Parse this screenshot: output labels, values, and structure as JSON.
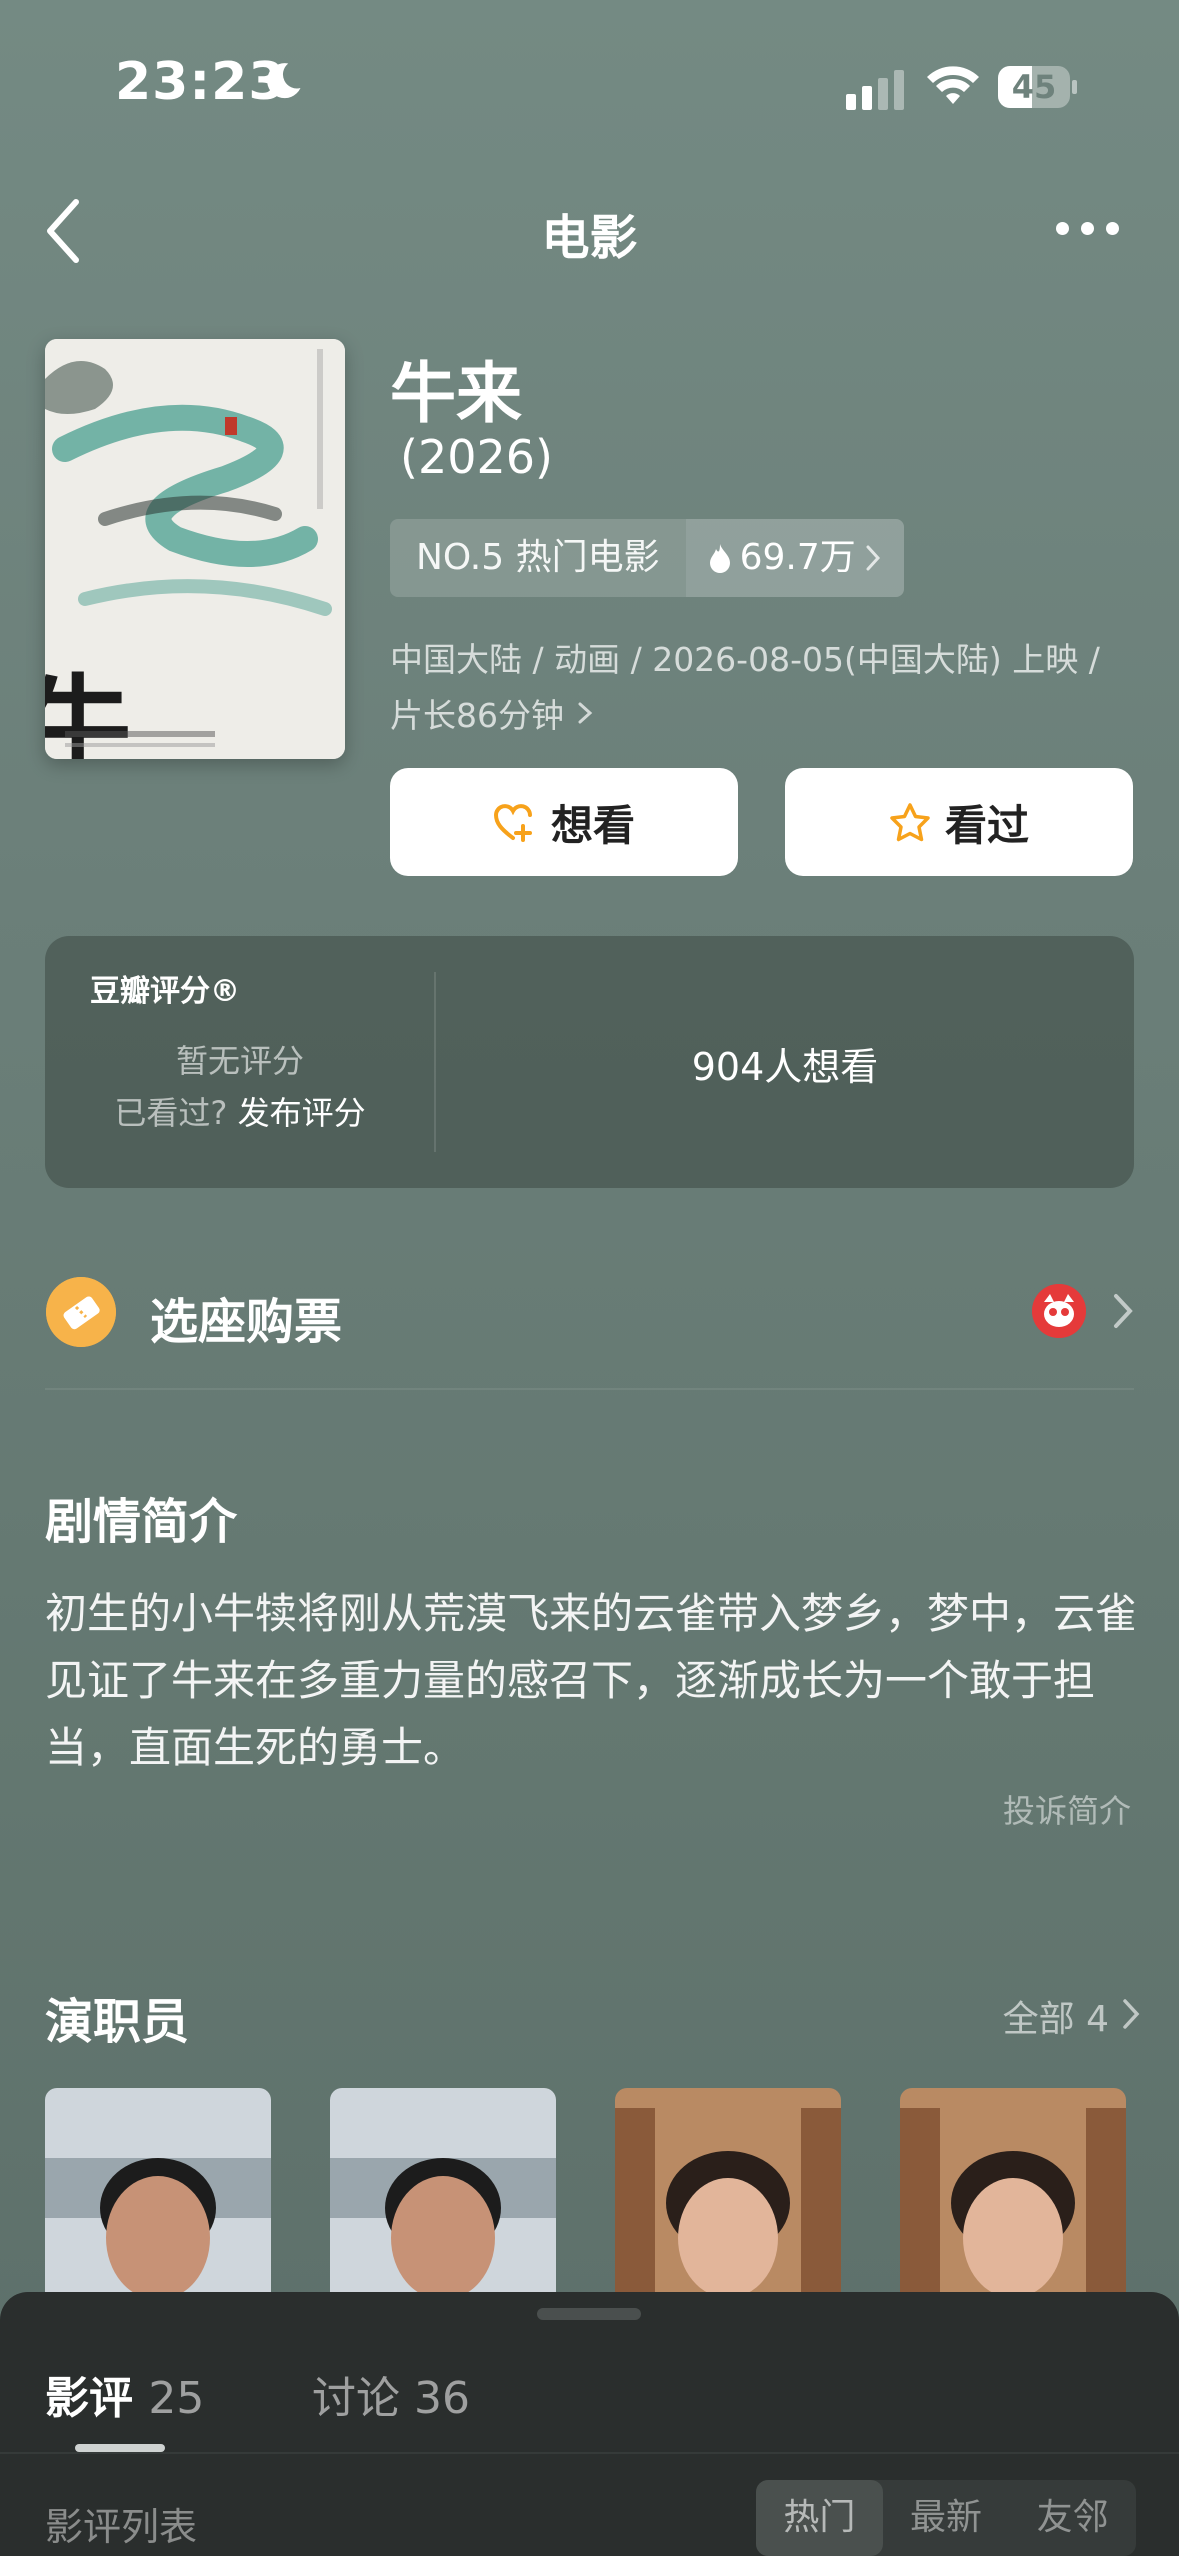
{
  "status": {
    "time": "23:23",
    "battery": "45"
  },
  "nav": {
    "title": "电影"
  },
  "movie": {
    "title": "牛来",
    "year": "(2026)",
    "rank": "NO.5 热门电影",
    "heat": "69.7万",
    "meta": "中国大陆 / 动画 / 2026-08-05(中国大陆) 上映 / 片长86分钟",
    "poster_text": "牛来"
  },
  "actions": {
    "want": "想看",
    "seen": "看过"
  },
  "rating": {
    "title": "豆瓣评分®",
    "no_rating": "暂无评分",
    "seen_question": "已看过?",
    "publish": "发布评分",
    "want_count": "904人想看"
  },
  "ticket": {
    "label": "选座购票"
  },
  "synopsis": {
    "title": "剧情简介",
    "text": "初生的小牛犊将刚从荒漠飞来的云雀带入梦乡，梦中，云雀见证了牛来在多重力量的感召下，逐渐成长为一个敢于担当，直面生死的勇士。",
    "complain": "投诉简介"
  },
  "cast": {
    "title": "演职员",
    "all": "全部 4"
  },
  "sheet": {
    "tab_reviews": "影评",
    "tab_reviews_count": "25",
    "tab_discuss": "讨论",
    "tab_discuss_count": "36",
    "list_label": "影评列表",
    "sort": [
      "热门",
      "最新",
      "友邻"
    ]
  },
  "colors": {
    "accent": "#f7a21b",
    "maoyan": "#e53a3a"
  }
}
